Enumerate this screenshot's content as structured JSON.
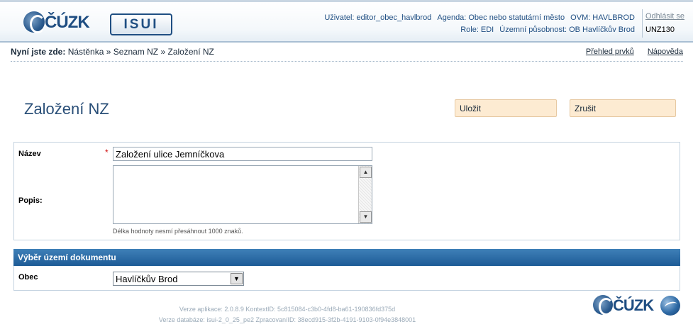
{
  "header": {
    "logo_cuzk": "ČÚZK",
    "logo_isui": "ISUI",
    "user_label": "Uživatel:",
    "user_value": "editor_obec_havlbrod",
    "agenda_label": "Agenda:",
    "agenda_value": "Obec nebo statutární město",
    "ovm_label": "OVM:",
    "ovm_value": "HAVLBROD",
    "role_label": "Role:",
    "role_value": "EDI",
    "territory_label": "Územní působnost:",
    "territory_value": "OB Havlíčkův Brod",
    "logout": "Odhlásit se",
    "screen_code": "UNZ130"
  },
  "breadcrumb": {
    "prefix": "Nyní jste zde:",
    "items": [
      "Nástěnka",
      "Seznam NZ",
      "Založení NZ"
    ],
    "separator": "»"
  },
  "toplinks": {
    "overview": "Přehled prvků",
    "help": "Nápověda"
  },
  "page": {
    "title": "Založení NZ",
    "save": "Uložit",
    "cancel": "Zrušit"
  },
  "form": {
    "name_label": "Název",
    "name_required_mark": "*",
    "name_value": "Založení ulice Jemníčkova",
    "desc_label": "Popis:",
    "desc_value": "",
    "desc_hint": "Délka hodnoty nesmí přesáhnout 1000 znaků."
  },
  "territory": {
    "section_title": "Výběr území dokumentu",
    "obec_label": "Obec",
    "obec_value": "Havlíčkův Brod"
  },
  "footer": {
    "line1": "Verze aplikace: 2.0.8.9 KontextID: 5c815084-c3b0-4fd8-ba61-190836fd375d",
    "line2": "Verze databáze: isui-2_0_25_pe2 ZpracovaníID: 38ecd915-3f2b-4191-9103-0f94e3848001",
    "logo_cuzk": "ČÚZK"
  }
}
